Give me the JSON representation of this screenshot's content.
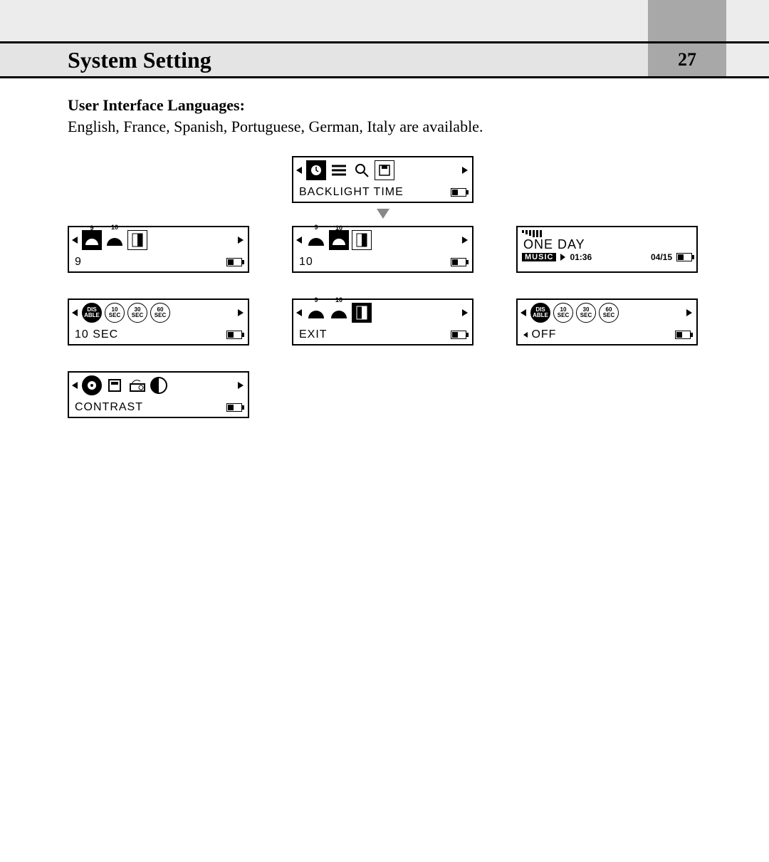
{
  "header": {
    "title": "System Setting",
    "page_number": "27"
  },
  "section": {
    "heading": "User Interface Languages",
    "heading_suffix": ":",
    "body": "English, France, Spanish, Portuguese, German, Italy  are available."
  },
  "screens": {
    "top": {
      "label": "BACKLIGHT TIME"
    },
    "row1": {
      "a": {
        "value": "9",
        "top_labels": [
          "9",
          "10"
        ]
      },
      "b": {
        "value": "10",
        "top_labels": [
          "9",
          "10"
        ]
      },
      "c": {
        "title": "ONE DAY",
        "music_tag": "MUSIC",
        "time": "01:36",
        "track": "04/15"
      }
    },
    "row2": {
      "a": {
        "value": "10 SEC",
        "icons": [
          "DIS ABLE",
          "10 SEC",
          "30 SEC",
          "60 SEC"
        ]
      },
      "b": {
        "value": "EXIT",
        "top_labels": [
          "9",
          "10"
        ]
      },
      "c": {
        "value": "OFF",
        "icons": [
          "DIS ABLE",
          "10 SEC",
          "30 SEC",
          "60 SEC"
        ]
      }
    },
    "row3": {
      "a": {
        "value": "CONTRAST"
      }
    }
  }
}
